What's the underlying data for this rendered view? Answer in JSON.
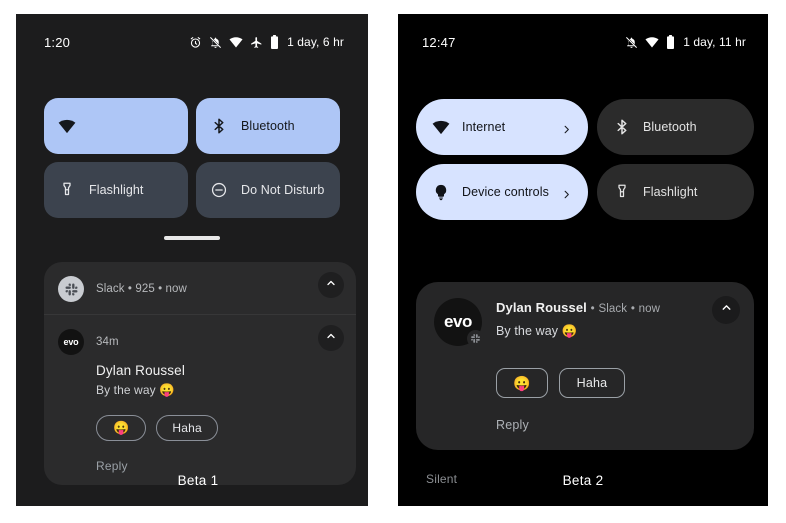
{
  "panels": [
    {
      "id": "beta1",
      "caption": "Beta 1",
      "status": {
        "clock": "1:20",
        "battery_text": "1 day, 6 hr",
        "icons": [
          "alarm-icon",
          "notifications-off-icon",
          "wifi-icon",
          "airplane-mode-icon",
          "battery-icon"
        ]
      },
      "tiles": [
        {
          "label": "",
          "icon": "wifi-icon",
          "state": "on"
        },
        {
          "label": "Bluetooth",
          "icon": "bluetooth-icon",
          "state": "on"
        },
        {
          "label": "Flashlight",
          "icon": "flashlight-icon",
          "state": "off"
        },
        {
          "label": "Do Not Disturb",
          "icon": "do-not-disturb-icon",
          "state": "off"
        }
      ],
      "notifications": [
        {
          "avatar_kind": "slack",
          "avatar_text": "",
          "meta": "Slack  •  925  •  now",
          "sender": "",
          "message": "",
          "has_body": false
        },
        {
          "avatar_kind": "evo",
          "avatar_text": "evo",
          "meta": "34m",
          "sender": "Dylan Roussel",
          "message": "By the way",
          "message_emoji": "😛",
          "has_body": true,
          "chips": [
            "😛",
            "Haha"
          ],
          "reply_label": "Reply"
        }
      ]
    },
    {
      "id": "beta2",
      "caption": "Beta 2",
      "status": {
        "clock": "12:47",
        "battery_text": "1 day, 11 hr",
        "icons": [
          "notifications-off-icon",
          "wifi-icon",
          "battery-icon"
        ]
      },
      "tiles": [
        {
          "label": "Internet",
          "icon": "wifi-icon",
          "state": "on",
          "chevron": true
        },
        {
          "label": "Bluetooth",
          "icon": "bluetooth-icon",
          "state": "off",
          "chevron": false
        },
        {
          "label": "Device controls",
          "icon": "device-controls-icon",
          "state": "on",
          "chevron": true
        },
        {
          "label": "Flashlight",
          "icon": "flashlight-icon",
          "state": "off",
          "chevron": false
        }
      ],
      "notification": {
        "avatar_text": "evo",
        "sender": "Dylan Roussel",
        "app": "Slack",
        "time": "now",
        "separator": "•",
        "message": "By the way",
        "message_emoji": "😛",
        "chips": [
          "😛",
          "Haha"
        ],
        "reply_label": "Reply"
      },
      "silent_label": "Silent"
    }
  ],
  "colors": {
    "tile_on_beta1": "#aec6f6",
    "tile_off_beta1": "#3c434e",
    "tile_on_beta2": "#d7e3ff",
    "tile_off_beta2": "#2b2b2b",
    "panel_bg_beta1": "#1c1c1d",
    "panel_bg_beta2": "#000000",
    "notif_bg_beta1": "#2b2b2c",
    "notif_bg_beta2": "#262627"
  }
}
